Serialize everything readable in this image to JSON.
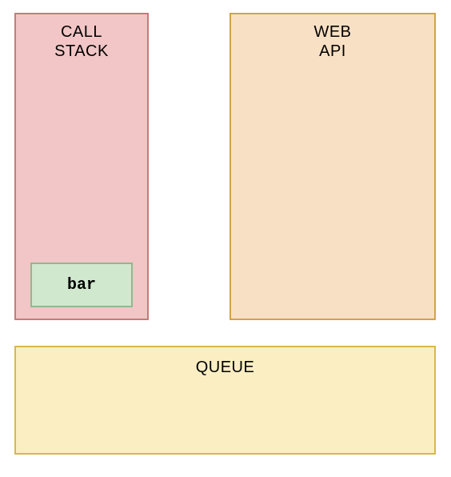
{
  "call_stack": {
    "title": "CALL\nSTACK",
    "items": [
      {
        "label": "bar"
      }
    ]
  },
  "web_api": {
    "title": "WEB\nAPI"
  },
  "queue": {
    "title": "QUEUE"
  },
  "colors": {
    "call_stack_bg": "#f2c6c6",
    "call_stack_border": "#c77a7a",
    "stack_item_bg": "#cfe8ce",
    "stack_item_border": "#8fb98f",
    "web_api_bg": "#f8e0c5",
    "web_api_border": "#d2a24c",
    "queue_bg": "#fbeec2",
    "queue_border": "#d6b84d"
  }
}
